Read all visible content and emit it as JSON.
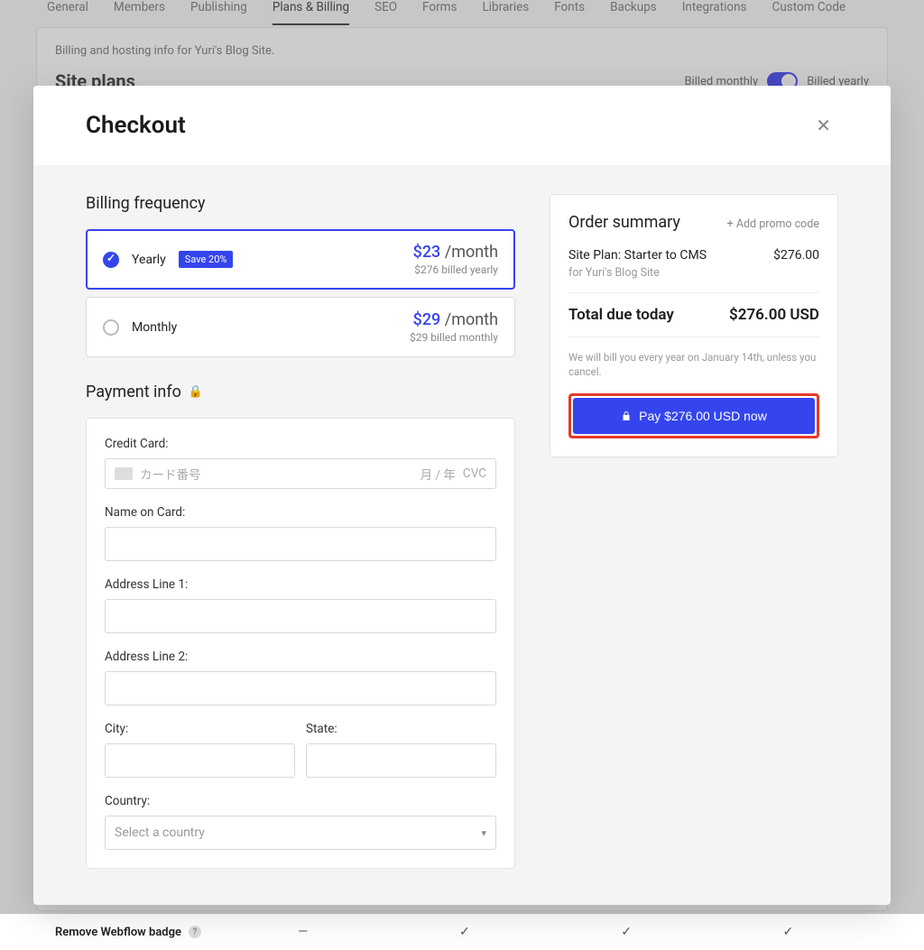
{
  "background": {
    "tabs": [
      "General",
      "Members",
      "Publishing",
      "Plans & Billing",
      "SEO",
      "Forms",
      "Libraries",
      "Fonts",
      "Backups",
      "Integrations",
      "Custom Code"
    ],
    "active_tab_index": 3,
    "subtitle": "Billing and hosting info for Yuri's Blog Site.",
    "section_title": "Site plans",
    "billing_switch": {
      "left": "Billed monthly",
      "right": "Billed yearly"
    },
    "feature_row_label": "Remove Webflow badge",
    "feature_cells": [
      "—",
      "✓",
      "✓",
      "✓"
    ]
  },
  "modal": {
    "title": "Checkout",
    "billing_frequency": {
      "title": "Billing frequency",
      "options": [
        {
          "label": "Yearly",
          "badge": "Save 20%",
          "price": "$23",
          "per": "/month",
          "sub": "$276 billed yearly",
          "selected": true
        },
        {
          "label": "Monthly",
          "badge": "",
          "price": "$29",
          "per": "/month",
          "sub": "$29 billed monthly",
          "selected": false
        }
      ]
    },
    "payment": {
      "title": "Payment info",
      "cc_label": "Credit Card:",
      "cc_placeholder": "カード番号",
      "cc_exp_placeholder": "月 / 年",
      "cc_cvc_placeholder": "CVC",
      "name_label": "Name on Card:",
      "addr1_label": "Address Line 1:",
      "addr2_label": "Address Line 2:",
      "city_label": "City:",
      "state_label": "State:",
      "country_label": "Country:",
      "country_placeholder": "Select a country"
    },
    "summary": {
      "title": "Order summary",
      "promo": "+ Add promo code",
      "item_title": "Site Plan: Starter to CMS",
      "item_sub": "for Yuri's Blog Site",
      "item_price": "$276.00",
      "total_label": "Total due today",
      "total_amount": "$276.00 USD",
      "note": "We will bill you every year on January 14th, unless you cancel.",
      "pay_button": "Pay $276.00 USD now"
    }
  }
}
